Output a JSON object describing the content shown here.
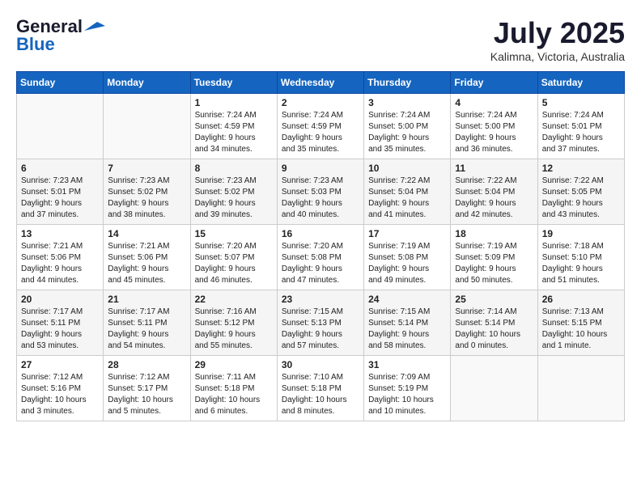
{
  "header": {
    "logo_line1": "General",
    "logo_line2": "Blue",
    "month": "July 2025",
    "location": "Kalimna, Victoria, Australia"
  },
  "weekdays": [
    "Sunday",
    "Monday",
    "Tuesday",
    "Wednesday",
    "Thursday",
    "Friday",
    "Saturday"
  ],
  "weeks": [
    [
      {
        "day": "",
        "info": ""
      },
      {
        "day": "",
        "info": ""
      },
      {
        "day": "1",
        "info": "Sunrise: 7:24 AM\nSunset: 4:59 PM\nDaylight: 9 hours\nand 34 minutes."
      },
      {
        "day": "2",
        "info": "Sunrise: 7:24 AM\nSunset: 4:59 PM\nDaylight: 9 hours\nand 35 minutes."
      },
      {
        "day": "3",
        "info": "Sunrise: 7:24 AM\nSunset: 5:00 PM\nDaylight: 9 hours\nand 35 minutes."
      },
      {
        "day": "4",
        "info": "Sunrise: 7:24 AM\nSunset: 5:00 PM\nDaylight: 9 hours\nand 36 minutes."
      },
      {
        "day": "5",
        "info": "Sunrise: 7:24 AM\nSunset: 5:01 PM\nDaylight: 9 hours\nand 37 minutes."
      }
    ],
    [
      {
        "day": "6",
        "info": "Sunrise: 7:23 AM\nSunset: 5:01 PM\nDaylight: 9 hours\nand 37 minutes."
      },
      {
        "day": "7",
        "info": "Sunrise: 7:23 AM\nSunset: 5:02 PM\nDaylight: 9 hours\nand 38 minutes."
      },
      {
        "day": "8",
        "info": "Sunrise: 7:23 AM\nSunset: 5:02 PM\nDaylight: 9 hours\nand 39 minutes."
      },
      {
        "day": "9",
        "info": "Sunrise: 7:23 AM\nSunset: 5:03 PM\nDaylight: 9 hours\nand 40 minutes."
      },
      {
        "day": "10",
        "info": "Sunrise: 7:22 AM\nSunset: 5:04 PM\nDaylight: 9 hours\nand 41 minutes."
      },
      {
        "day": "11",
        "info": "Sunrise: 7:22 AM\nSunset: 5:04 PM\nDaylight: 9 hours\nand 42 minutes."
      },
      {
        "day": "12",
        "info": "Sunrise: 7:22 AM\nSunset: 5:05 PM\nDaylight: 9 hours\nand 43 minutes."
      }
    ],
    [
      {
        "day": "13",
        "info": "Sunrise: 7:21 AM\nSunset: 5:06 PM\nDaylight: 9 hours\nand 44 minutes."
      },
      {
        "day": "14",
        "info": "Sunrise: 7:21 AM\nSunset: 5:06 PM\nDaylight: 9 hours\nand 45 minutes."
      },
      {
        "day": "15",
        "info": "Sunrise: 7:20 AM\nSunset: 5:07 PM\nDaylight: 9 hours\nand 46 minutes."
      },
      {
        "day": "16",
        "info": "Sunrise: 7:20 AM\nSunset: 5:08 PM\nDaylight: 9 hours\nand 47 minutes."
      },
      {
        "day": "17",
        "info": "Sunrise: 7:19 AM\nSunset: 5:08 PM\nDaylight: 9 hours\nand 49 minutes."
      },
      {
        "day": "18",
        "info": "Sunrise: 7:19 AM\nSunset: 5:09 PM\nDaylight: 9 hours\nand 50 minutes."
      },
      {
        "day": "19",
        "info": "Sunrise: 7:18 AM\nSunset: 5:10 PM\nDaylight: 9 hours\nand 51 minutes."
      }
    ],
    [
      {
        "day": "20",
        "info": "Sunrise: 7:17 AM\nSunset: 5:11 PM\nDaylight: 9 hours\nand 53 minutes."
      },
      {
        "day": "21",
        "info": "Sunrise: 7:17 AM\nSunset: 5:11 PM\nDaylight: 9 hours\nand 54 minutes."
      },
      {
        "day": "22",
        "info": "Sunrise: 7:16 AM\nSunset: 5:12 PM\nDaylight: 9 hours\nand 55 minutes."
      },
      {
        "day": "23",
        "info": "Sunrise: 7:15 AM\nSunset: 5:13 PM\nDaylight: 9 hours\nand 57 minutes."
      },
      {
        "day": "24",
        "info": "Sunrise: 7:15 AM\nSunset: 5:14 PM\nDaylight: 9 hours\nand 58 minutes."
      },
      {
        "day": "25",
        "info": "Sunrise: 7:14 AM\nSunset: 5:14 PM\nDaylight: 10 hours\nand 0 minutes."
      },
      {
        "day": "26",
        "info": "Sunrise: 7:13 AM\nSunset: 5:15 PM\nDaylight: 10 hours\nand 1 minute."
      }
    ],
    [
      {
        "day": "27",
        "info": "Sunrise: 7:12 AM\nSunset: 5:16 PM\nDaylight: 10 hours\nand 3 minutes."
      },
      {
        "day": "28",
        "info": "Sunrise: 7:12 AM\nSunset: 5:17 PM\nDaylight: 10 hours\nand 5 minutes."
      },
      {
        "day": "29",
        "info": "Sunrise: 7:11 AM\nSunset: 5:18 PM\nDaylight: 10 hours\nand 6 minutes."
      },
      {
        "day": "30",
        "info": "Sunrise: 7:10 AM\nSunset: 5:18 PM\nDaylight: 10 hours\nand 8 minutes."
      },
      {
        "day": "31",
        "info": "Sunrise: 7:09 AM\nSunset: 5:19 PM\nDaylight: 10 hours\nand 10 minutes."
      },
      {
        "day": "",
        "info": ""
      },
      {
        "day": "",
        "info": ""
      }
    ]
  ]
}
